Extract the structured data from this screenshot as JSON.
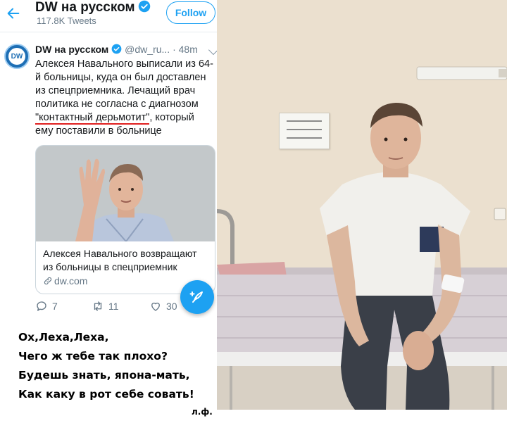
{
  "header": {
    "account_name": "DW на русском",
    "tweet_count": "117.8K Tweets",
    "follow_label": "Follow"
  },
  "tweet": {
    "display_name": "DW на русском",
    "handle_time": "@dw_ru... · 48m",
    "avatar_text": "DW",
    "lines": [
      "Алексея Навального выписали из 64-",
      "й больницы, куда он был доставлен",
      "из спецприемника. Лечащий врач",
      "политика не согласна с диагнозом",
      "\"контактный дерьмотит\"",
      ", который",
      "ему поставили в больнице"
    ]
  },
  "card": {
    "title_lines": [
      "Алексея Навального возвращают",
      "из больницы в спецприемник"
    ],
    "domain": "dw.com"
  },
  "actions": {
    "replies": "7",
    "retweets": "11",
    "likes": "30"
  },
  "poem": {
    "lines": [
      "Ох,Леха,Леха,",
      "Чего ж тебе так плохо?",
      "Будешь знать, япона-мать,",
      "Как каку в рот себе совать!"
    ],
    "signature": "л.ф."
  },
  "colors": {
    "twitter_blue": "#1da1f2",
    "underline_red": "#e02020",
    "wall": "#e9ddcc"
  }
}
